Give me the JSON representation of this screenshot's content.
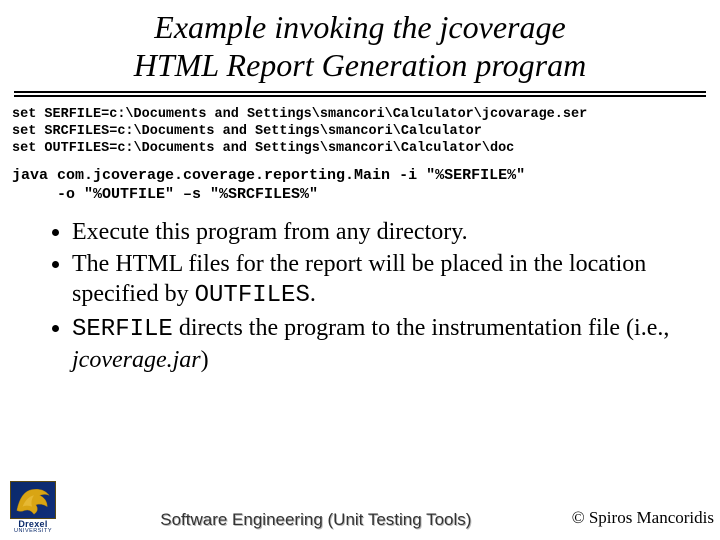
{
  "title_line1": "Example invoking the jcoverage",
  "title_line2": "HTML Report Generation program",
  "code": {
    "l1": "set SERFILE=c:\\Documents and Settings\\smancori\\Calculator\\jcovarage.ser",
    "l2": "set SRCFILES=c:\\Documents and Settings\\smancori\\Calculator",
    "l3": "set OUTFILES=c:\\Documents and Settings\\smancori\\Calculator\\doc"
  },
  "java": {
    "l1": "java com.jcoverage.coverage.reporting.Main -i \"%SERFILE%\"",
    "l2": "     -o \"%OUTFILE\" –s \"%SRCFILES%\""
  },
  "bullets": {
    "b1": "Execute this program from any directory.",
    "b2a": "The HTML files for the report will be placed in the location specified by ",
    "b2b": "OUTFILES",
    "b2c": ".",
    "b3a": "SERFILE",
    "b3b": " directs the program to the instrumentation file (i.e., ",
    "b3c": "jcoverage.jar",
    "b3d": ")"
  },
  "footer": {
    "logo_name": "Drexel",
    "logo_sub": "UNIVERSITY",
    "center_a": "Software Engineering ",
    "center_b": "(Unit Testing Tools)",
    "copyright": "© Spiros Mancoridis"
  }
}
